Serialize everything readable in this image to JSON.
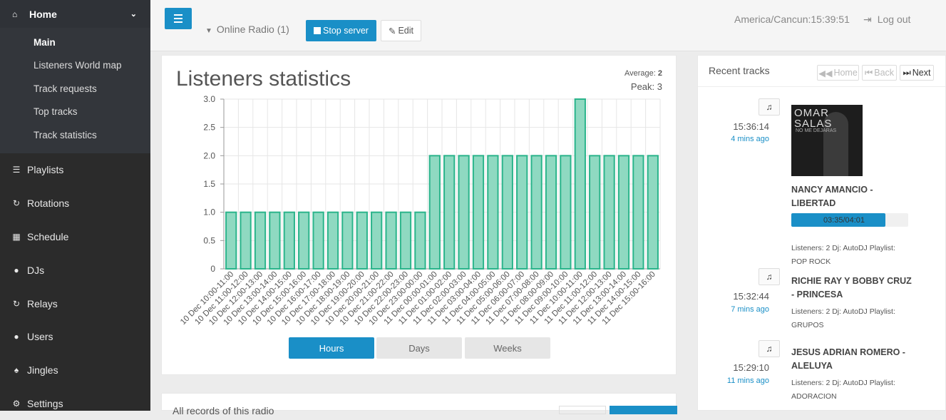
{
  "sidebar": {
    "home": {
      "icon": "home-icon",
      "label": "Home"
    },
    "sub_items": [
      {
        "label": "Main",
        "active": true
      },
      {
        "label": "Listeners World map",
        "active": false
      },
      {
        "label": "Track requests",
        "active": false
      },
      {
        "label": "Top tracks",
        "active": false
      },
      {
        "label": "Track statistics",
        "active": false
      }
    ],
    "items": [
      {
        "icon": "list-icon",
        "label": "Playlists",
        "glyph": "☰"
      },
      {
        "icon": "refresh-icon",
        "label": "Rotations",
        "glyph": "↻"
      },
      {
        "icon": "calendar-icon",
        "label": "Schedule",
        "glyph": "▦"
      },
      {
        "icon": "user-icon",
        "label": "DJs",
        "glyph": "●"
      },
      {
        "icon": "rotate-icon",
        "label": "Relays",
        "glyph": "↻"
      },
      {
        "icon": "users-icon",
        "label": "Users",
        "glyph": "●"
      },
      {
        "icon": "bell-icon",
        "label": "Jingles",
        "glyph": "♠"
      },
      {
        "icon": "gears-icon",
        "label": "Settings",
        "glyph": "⚙"
      }
    ]
  },
  "topbar": {
    "station": "Online Radio (1)",
    "stop_label": "Stop server",
    "edit_label": "Edit",
    "clock": "America/Cancun:15:39:51",
    "logout_label": "Log out"
  },
  "stats": {
    "title": "Listeners statistics",
    "average_label": "Average:",
    "average_value": "2",
    "peak": "Peak: 3",
    "ranges": [
      {
        "label": "Hours",
        "active": true
      },
      {
        "label": "Days",
        "active": false
      },
      {
        "label": "Weeks",
        "active": false
      }
    ]
  },
  "chart_data": {
    "type": "bar",
    "categories": [
      "10 Dec 10:00-11:00",
      "10 Dec 11:00-12:00",
      "10 Dec 12:00-13:00",
      "10 Dec 13:00-14:00",
      "10 Dec 14:00-15:00",
      "10 Dec 15:00-16:00",
      "10 Dec 16:00-17:00",
      "10 Dec 17:00-18:00",
      "10 Dec 18:00-19:00",
      "10 Dec 19:00-20:00",
      "10 Dec 20:00-21:00",
      "10 Dec 21:00-22:00",
      "10 Dec 22:00-23:00",
      "10 Dec 23:00-00:00",
      "11 Dec 00:00-01:00",
      "11 Dec 01:00-02:00",
      "11 Dec 02:00-03:00",
      "11 Dec 03:00-04:00",
      "11 Dec 04:00-05:00",
      "11 Dec 05:00-06:00",
      "11 Dec 06:00-07:00",
      "11 Dec 07:00-08:00",
      "11 Dec 08:00-09:00",
      "11 Dec 09:00-10:00",
      "11 Dec 10:00-11:00",
      "11 Dec 11:00-12:00",
      "11 Dec 12:00-13:00",
      "11 Dec 13:00-14:00",
      "11 Dec 14:00-15:00",
      "11 Dec 15:00-16:00"
    ],
    "values": [
      1,
      1,
      1,
      1,
      1,
      1,
      1,
      1,
      1,
      1,
      1,
      1,
      1,
      1,
      2,
      2,
      2,
      2,
      2,
      2,
      2,
      2,
      2,
      2,
      3,
      2,
      2,
      2,
      2,
      2
    ],
    "yticks": [
      "0",
      "0.5",
      "1.0",
      "1.5",
      "2.0",
      "2.5",
      "3.0"
    ],
    "ylim": [
      0,
      3
    ],
    "grid": true,
    "colors": {
      "fill": "#8fd9c1",
      "stroke": "#2bb48b",
      "grid": "#e6e6e6"
    }
  },
  "recent": {
    "title": "Recent tracks",
    "home_label": "Home",
    "back_label": "Back",
    "next_label": "Next",
    "tracks": [
      {
        "time": "15:36:14",
        "ago": "4 mins ago",
        "title": "NANCY AMANCIO - LIBERTAD",
        "progress_text": "03:35/04:01",
        "progress_fraction": 0.892,
        "meta": "Listeners: 2 Dj: AutoDJ Playlist: POP ROCK",
        "cover": {
          "line1": "OMAR",
          "line2": "SALAS",
          "line3": "NO ME DEJARAS"
        }
      },
      {
        "time": "15:32:44",
        "ago": "7 mins ago",
        "title": "RICHIE RAY Y BOBBY CRUZ - PRINCESA",
        "meta": "Listeners: 2 Dj: AutoDJ Playlist: GRUPOS"
      },
      {
        "time": "15:29:10",
        "ago": "11 mins ago",
        "title": "JESUS ADRIAN ROMERO - ALELUYA",
        "meta": "Listeners: 2 Dj: AutoDJ Playlist: ADORACION"
      }
    ]
  },
  "bottom": {
    "partial_title": "All records of this radio"
  },
  "colors": {
    "accent": "#1a8fc7",
    "sidebar": "#2b2b2b"
  }
}
